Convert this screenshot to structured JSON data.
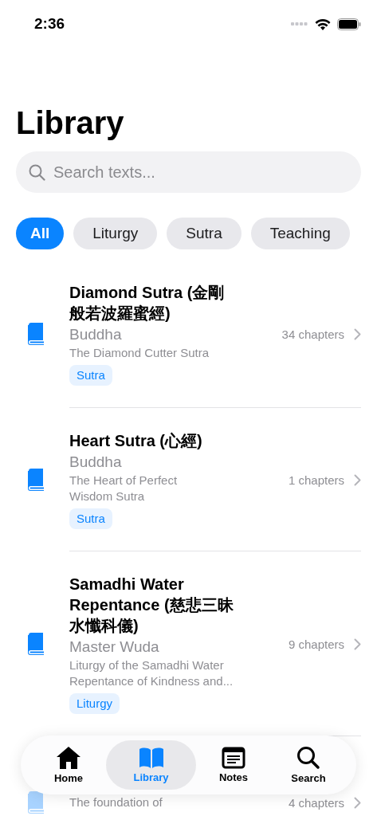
{
  "status_bar": {
    "time": "2:36"
  },
  "header": {
    "title": "Library"
  },
  "search": {
    "placeholder": "Search texts..."
  },
  "filters": [
    {
      "label": "All",
      "selected": true
    },
    {
      "label": "Liturgy",
      "selected": false
    },
    {
      "label": "Sutra",
      "selected": false
    },
    {
      "label": "Teaching",
      "selected": false
    }
  ],
  "texts": [
    {
      "title": "Diamond Sutra (金剛般若波羅蜜經)",
      "author": "Buddha",
      "description": "The Diamond Cutter Sutra",
      "chapters": "34 chapters",
      "tag": "Sutra"
    },
    {
      "title": "Heart Sutra (心經)",
      "author": "Buddha",
      "description": "The Heart of Perfect\nWisdom Sutra",
      "chapters": "1 chapters",
      "tag": "Sutra"
    },
    {
      "title": "Samadhi Water Repentance (慈悲三昧水懺科儀)",
      "author": "Master Wuda",
      "description": "Liturgy of the Samadhi Water Repentance of Kindness and...",
      "chapters": "9 chapters",
      "tag": "Liturgy"
    },
    {
      "description": "The foundation of",
      "chapters": "4 chapters"
    }
  ],
  "tab_bar": [
    {
      "label": "Home",
      "selected": false
    },
    {
      "label": "Library",
      "selected": true
    },
    {
      "label": "Notes",
      "selected": false
    },
    {
      "label": "Search",
      "selected": false
    }
  ]
}
